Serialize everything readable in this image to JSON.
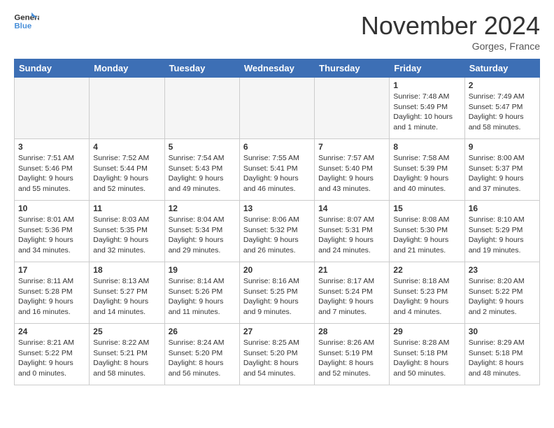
{
  "header": {
    "logo_line1": "General",
    "logo_line2": "Blue",
    "month": "November 2024",
    "location": "Gorges, France"
  },
  "days_of_week": [
    "Sunday",
    "Monday",
    "Tuesday",
    "Wednesday",
    "Thursday",
    "Friday",
    "Saturday"
  ],
  "weeks": [
    [
      {
        "day": "",
        "detail": "",
        "empty": true
      },
      {
        "day": "",
        "detail": "",
        "empty": true
      },
      {
        "day": "",
        "detail": "",
        "empty": true
      },
      {
        "day": "",
        "detail": "",
        "empty": true
      },
      {
        "day": "",
        "detail": "",
        "empty": true
      },
      {
        "day": "1",
        "detail": "Sunrise: 7:48 AM\nSunset: 5:49 PM\nDaylight: 10 hours and 1 minute."
      },
      {
        "day": "2",
        "detail": "Sunrise: 7:49 AM\nSunset: 5:47 PM\nDaylight: 9 hours and 58 minutes."
      }
    ],
    [
      {
        "day": "3",
        "detail": "Sunrise: 7:51 AM\nSunset: 5:46 PM\nDaylight: 9 hours and 55 minutes."
      },
      {
        "day": "4",
        "detail": "Sunrise: 7:52 AM\nSunset: 5:44 PM\nDaylight: 9 hours and 52 minutes."
      },
      {
        "day": "5",
        "detail": "Sunrise: 7:54 AM\nSunset: 5:43 PM\nDaylight: 9 hours and 49 minutes."
      },
      {
        "day": "6",
        "detail": "Sunrise: 7:55 AM\nSunset: 5:41 PM\nDaylight: 9 hours and 46 minutes."
      },
      {
        "day": "7",
        "detail": "Sunrise: 7:57 AM\nSunset: 5:40 PM\nDaylight: 9 hours and 43 minutes."
      },
      {
        "day": "8",
        "detail": "Sunrise: 7:58 AM\nSunset: 5:39 PM\nDaylight: 9 hours and 40 minutes."
      },
      {
        "day": "9",
        "detail": "Sunrise: 8:00 AM\nSunset: 5:37 PM\nDaylight: 9 hours and 37 minutes."
      }
    ],
    [
      {
        "day": "10",
        "detail": "Sunrise: 8:01 AM\nSunset: 5:36 PM\nDaylight: 9 hours and 34 minutes."
      },
      {
        "day": "11",
        "detail": "Sunrise: 8:03 AM\nSunset: 5:35 PM\nDaylight: 9 hours and 32 minutes."
      },
      {
        "day": "12",
        "detail": "Sunrise: 8:04 AM\nSunset: 5:34 PM\nDaylight: 9 hours and 29 minutes."
      },
      {
        "day": "13",
        "detail": "Sunrise: 8:06 AM\nSunset: 5:32 PM\nDaylight: 9 hours and 26 minutes."
      },
      {
        "day": "14",
        "detail": "Sunrise: 8:07 AM\nSunset: 5:31 PM\nDaylight: 9 hours and 24 minutes."
      },
      {
        "day": "15",
        "detail": "Sunrise: 8:08 AM\nSunset: 5:30 PM\nDaylight: 9 hours and 21 minutes."
      },
      {
        "day": "16",
        "detail": "Sunrise: 8:10 AM\nSunset: 5:29 PM\nDaylight: 9 hours and 19 minutes."
      }
    ],
    [
      {
        "day": "17",
        "detail": "Sunrise: 8:11 AM\nSunset: 5:28 PM\nDaylight: 9 hours and 16 minutes."
      },
      {
        "day": "18",
        "detail": "Sunrise: 8:13 AM\nSunset: 5:27 PM\nDaylight: 9 hours and 14 minutes."
      },
      {
        "day": "19",
        "detail": "Sunrise: 8:14 AM\nSunset: 5:26 PM\nDaylight: 9 hours and 11 minutes."
      },
      {
        "day": "20",
        "detail": "Sunrise: 8:16 AM\nSunset: 5:25 PM\nDaylight: 9 hours and 9 minutes."
      },
      {
        "day": "21",
        "detail": "Sunrise: 8:17 AM\nSunset: 5:24 PM\nDaylight: 9 hours and 7 minutes."
      },
      {
        "day": "22",
        "detail": "Sunrise: 8:18 AM\nSunset: 5:23 PM\nDaylight: 9 hours and 4 minutes."
      },
      {
        "day": "23",
        "detail": "Sunrise: 8:20 AM\nSunset: 5:22 PM\nDaylight: 9 hours and 2 minutes."
      }
    ],
    [
      {
        "day": "24",
        "detail": "Sunrise: 8:21 AM\nSunset: 5:22 PM\nDaylight: 9 hours and 0 minutes."
      },
      {
        "day": "25",
        "detail": "Sunrise: 8:22 AM\nSunset: 5:21 PM\nDaylight: 8 hours and 58 minutes."
      },
      {
        "day": "26",
        "detail": "Sunrise: 8:24 AM\nSunset: 5:20 PM\nDaylight: 8 hours and 56 minutes."
      },
      {
        "day": "27",
        "detail": "Sunrise: 8:25 AM\nSunset: 5:20 PM\nDaylight: 8 hours and 54 minutes."
      },
      {
        "day": "28",
        "detail": "Sunrise: 8:26 AM\nSunset: 5:19 PM\nDaylight: 8 hours and 52 minutes."
      },
      {
        "day": "29",
        "detail": "Sunrise: 8:28 AM\nSunset: 5:18 PM\nDaylight: 8 hours and 50 minutes."
      },
      {
        "day": "30",
        "detail": "Sunrise: 8:29 AM\nSunset: 5:18 PM\nDaylight: 8 hours and 48 minutes."
      }
    ]
  ]
}
